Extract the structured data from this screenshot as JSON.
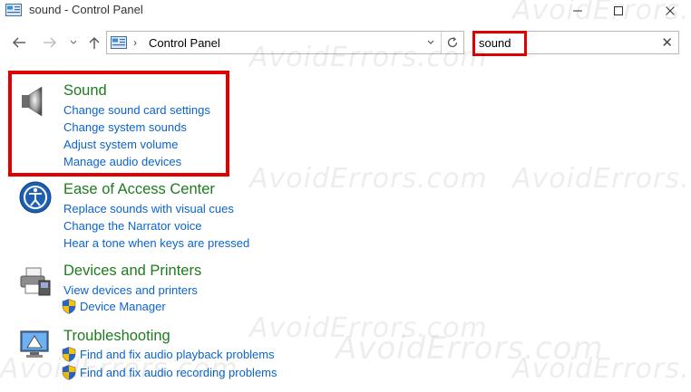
{
  "window": {
    "title": "sound - Control Panel",
    "buttons": [
      "minimize",
      "maximize",
      "close"
    ]
  },
  "nav": {
    "breadcrumb": [
      "Control Panel"
    ],
    "search_value": "sound",
    "search_placeholder": ""
  },
  "results": [
    {
      "title": "Sound",
      "icon": "speaker-icon",
      "links": [
        {
          "label": "Change sound card settings",
          "shield": false
        },
        {
          "label": "Change system sounds",
          "shield": false
        },
        {
          "label": "Adjust system volume",
          "shield": false
        },
        {
          "label": "Manage audio devices",
          "shield": false
        }
      ]
    },
    {
      "title": "Ease of Access Center",
      "icon": "ease-of-access-icon",
      "links": [
        {
          "label": "Replace sounds with visual cues",
          "shield": false
        },
        {
          "label": "Change the Narrator voice",
          "shield": false
        },
        {
          "label": "Hear a tone when keys are pressed",
          "shield": false
        }
      ]
    },
    {
      "title": "Devices and Printers",
      "icon": "printer-icon",
      "links": [
        {
          "label": "View devices and printers",
          "shield": false
        },
        {
          "label": "Device Manager",
          "shield": true
        }
      ]
    },
    {
      "title": "Troubleshooting",
      "icon": "troubleshooting-icon",
      "links": [
        {
          "label": "Find and fix audio playback problems",
          "shield": true
        },
        {
          "label": "Find and fix audio recording problems",
          "shield": true
        }
      ]
    }
  ],
  "watermark": "AvoidErrors.com",
  "colors": {
    "title_green": "#1e7b1e",
    "link_blue": "#0b64cc",
    "highlight_red": "#e00000"
  }
}
